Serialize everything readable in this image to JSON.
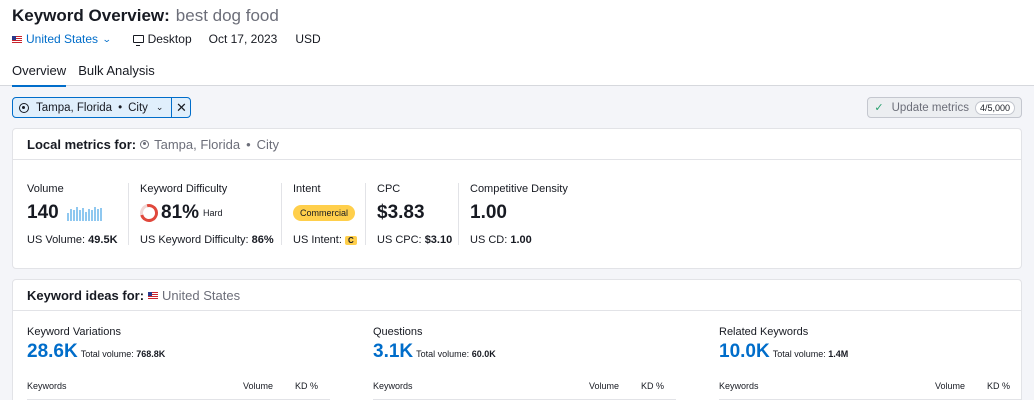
{
  "header": {
    "title": "Keyword Overview:",
    "query": "best dog food",
    "database": "United States",
    "device": "Desktop",
    "date": "Oct 17, 2023",
    "currency": "USD"
  },
  "tabs": [
    {
      "label": "Overview",
      "active": true
    },
    {
      "label": "Bulk Analysis",
      "active": false
    }
  ],
  "location_filter": {
    "city": "Tampa, Florida",
    "type": "City"
  },
  "update_metrics": {
    "label": "Update metrics",
    "limit": "4/5,000"
  },
  "local_metrics": {
    "heading": "Local metrics for:",
    "location": "Tampa, Florida",
    "type": "City",
    "volume": {
      "label": "Volume",
      "value": "140",
      "sub_label": "US Volume:",
      "sub_value": "49.5K",
      "trend": [
        0.55,
        0.8,
        0.7,
        0.9,
        0.75,
        0.85,
        0.6,
        0.8,
        0.7,
        0.9,
        0.8,
        0.85
      ]
    },
    "kd": {
      "label": "Keyword Difficulty",
      "value": "81%",
      "level": "Hard",
      "sub_label": "US Keyword Difficulty:",
      "sub_value": "86%"
    },
    "intent": {
      "label": "Intent",
      "value": "Commercial",
      "sub_label": "US Intent:",
      "sub_value": "C"
    },
    "cpc": {
      "label": "CPC",
      "value": "$3.83",
      "sub_label": "US CPC:",
      "sub_value": "$3.10"
    },
    "cd": {
      "label": "Competitive Density",
      "value": "1.00",
      "sub_label": "US CD:",
      "sub_value": "1.00"
    }
  },
  "keyword_ideas": {
    "heading": "Keyword ideas for:",
    "location": "United States",
    "columns": [
      "Keywords",
      "Volume",
      "KD %"
    ],
    "groups": [
      {
        "label": "Keyword Variations",
        "value": "28.6K",
        "total_label": "Total volume:",
        "total": "768.8K"
      },
      {
        "label": "Questions",
        "value": "3.1K",
        "total_label": "Total volume:",
        "total": "60.0K"
      },
      {
        "label": "Related Keywords",
        "value": "10.0K",
        "total_label": "Total volume:",
        "total": "1.4M"
      }
    ]
  },
  "colors": {
    "accent": "#006dca",
    "kd_hard": "#e0483c",
    "intent_commercial": "#ffcf4b"
  }
}
